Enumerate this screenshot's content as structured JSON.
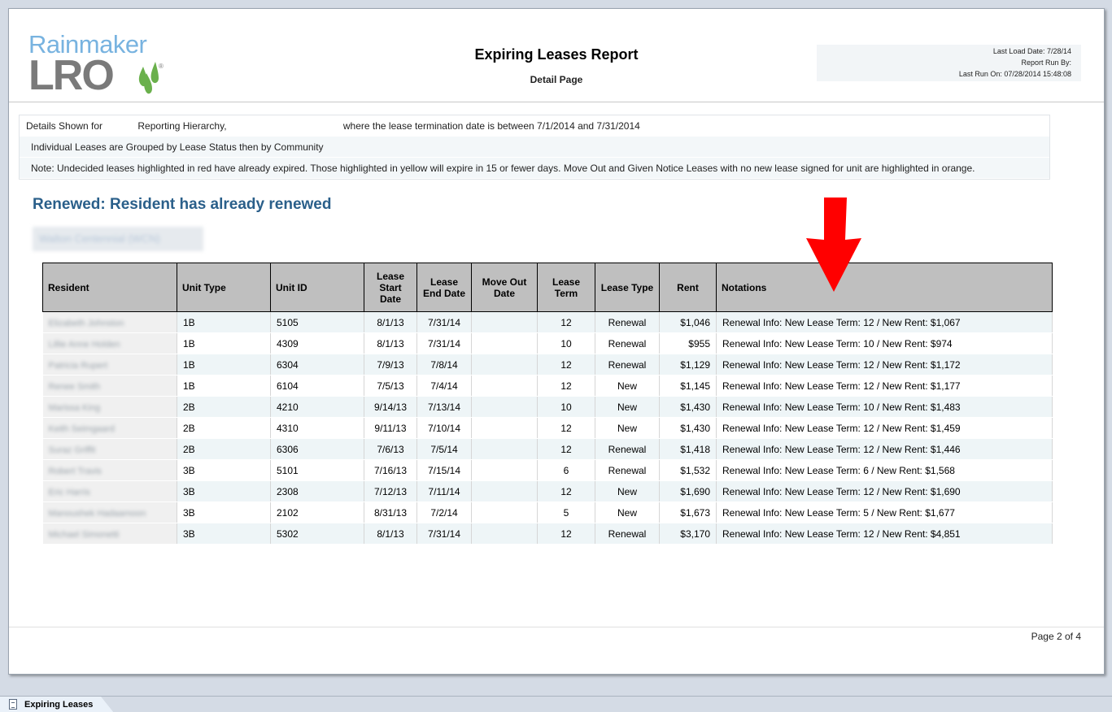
{
  "header": {
    "logo_top": "Rainmaker",
    "logo_bottom": "LRO",
    "logo_reg": "®",
    "title": "Expiring Leases Report",
    "subtitle": "Detail Page",
    "meta": {
      "last_load": "Last Load Date: 7/28/14",
      "run_by": "Report Run By:",
      "last_run": "Last Run On: 07/28/2014 15:48:08"
    }
  },
  "criteria": {
    "line1_label": "Details Shown for",
    "line1_hierarchy": "Reporting Hierarchy,",
    "line1_range": "where the lease termination date is between 7/1/2014  and 7/31/2014",
    "line2": "Individual Leases are Grouped by Lease Status then by Community",
    "line3": "Note: Undecided leases highlighted in red have already expired. Those highlighted in yellow will expire in 15 or fewer days. Move Out and Given Notice Leases with no new lease signed for unit are highlighted in orange."
  },
  "section": {
    "title": "Renewed: Resident has already renewed",
    "community": "Walton Centennial (WCN)"
  },
  "table": {
    "headers": {
      "resident": "Resident",
      "unit_type": "Unit Type",
      "unit_id": "Unit ID",
      "lease_start": "Lease Start Date",
      "lease_end": "Lease End Date",
      "move_out": "Move Out Date",
      "lease_term": "Lease Term",
      "lease_type": "Lease Type",
      "rent": "Rent",
      "notations": "Notations"
    },
    "rows": [
      {
        "resident": "Elizabeth Johnston",
        "unit_type": "1B",
        "unit_id": "5105",
        "start": "8/1/13",
        "end": "7/31/14",
        "move_out": "",
        "term": "12",
        "type": "Renewal",
        "rent": "$1,046",
        "notation": "Renewal Info: New Lease Term: 12   /   New Rent: $1,067"
      },
      {
        "resident": "Lillie Anne Holden",
        "unit_type": "1B",
        "unit_id": "4309",
        "start": "8/1/13",
        "end": "7/31/14",
        "move_out": "",
        "term": "10",
        "type": "Renewal",
        "rent": "$955",
        "notation": "Renewal Info: New Lease Term: 10   /   New Rent: $974"
      },
      {
        "resident": "Patricia Rupert",
        "unit_type": "1B",
        "unit_id": "6304",
        "start": "7/9/13",
        "end": "7/8/14",
        "move_out": "",
        "term": "12",
        "type": "Renewal",
        "rent": "$1,129",
        "notation": "Renewal Info: New Lease Term: 12   /   New Rent: $1,172"
      },
      {
        "resident": "Renee Smith",
        "unit_type": "1B",
        "unit_id": "6104",
        "start": "7/5/13",
        "end": "7/4/14",
        "move_out": "",
        "term": "12",
        "type": "New",
        "rent": "$1,145",
        "notation": "Renewal Info: New Lease Term: 12   /   New Rent: $1,177"
      },
      {
        "resident": "Marissa King",
        "unit_type": "2B",
        "unit_id": "4210",
        "start": "9/14/13",
        "end": "7/13/14",
        "move_out": "",
        "term": "10",
        "type": "New",
        "rent": "$1,430",
        "notation": "Renewal Info: New Lease Term: 10   /   New Rent: $1,483"
      },
      {
        "resident": "Keith Seimgaard",
        "unit_type": "2B",
        "unit_id": "4310",
        "start": "9/11/13",
        "end": "7/10/14",
        "move_out": "",
        "term": "12",
        "type": "New",
        "rent": "$1,430",
        "notation": "Renewal Info: New Lease Term: 12   /   New Rent: $1,459"
      },
      {
        "resident": "Suraz Griffit",
        "unit_type": "2B",
        "unit_id": "6306",
        "start": "7/6/13",
        "end": "7/5/14",
        "move_out": "",
        "term": "12",
        "type": "Renewal",
        "rent": "$1,418",
        "notation": "Renewal Info: New Lease Term: 12   /   New Rent: $1,446"
      },
      {
        "resident": "Robert Travis",
        "unit_type": "3B",
        "unit_id": "5101",
        "start": "7/16/13",
        "end": "7/15/14",
        "move_out": "",
        "term": "6",
        "type": "Renewal",
        "rent": "$1,532",
        "notation": "Renewal Info: New Lease Term: 6   /   New Rent: $1,568"
      },
      {
        "resident": "Eric Harris",
        "unit_type": "3B",
        "unit_id": "2308",
        "start": "7/12/13",
        "end": "7/11/14",
        "move_out": "",
        "term": "12",
        "type": "New",
        "rent": "$1,690",
        "notation": "Renewal Info: New Lease Term: 12   /   New Rent: $1,690"
      },
      {
        "resident": "Manoushek Hadaamoon",
        "unit_type": "3B",
        "unit_id": "2102",
        "start": "8/31/13",
        "end": "7/2/14",
        "move_out": "",
        "term": "5",
        "type": "New",
        "rent": "$1,673",
        "notation": "Renewal Info: New Lease Term: 5   /   New Rent: $1,677"
      },
      {
        "resident": "Michael Simonetti",
        "unit_type": "3B",
        "unit_id": "5302",
        "start": "8/1/13",
        "end": "7/31/14",
        "move_out": "",
        "term": "12",
        "type": "Renewal",
        "rent": "$3,170",
        "notation": "Renewal Info: New Lease Term: 12   /   New Rent: $4,851"
      }
    ]
  },
  "footer": {
    "page": "Page 2 of 4"
  },
  "tabs": [
    {
      "label": "Expiring Leases",
      "icon": "document-icon"
    }
  ],
  "colors": {
    "section_title": "#2a5f8a",
    "header_fill": "#bfbfbf",
    "row_alt": "#eef5f7",
    "annotation_arrow": "#ff0000",
    "logo_blue": "#78b3e0",
    "logo_gray": "#7a7a7a",
    "logo_green": "#6ab04c"
  }
}
